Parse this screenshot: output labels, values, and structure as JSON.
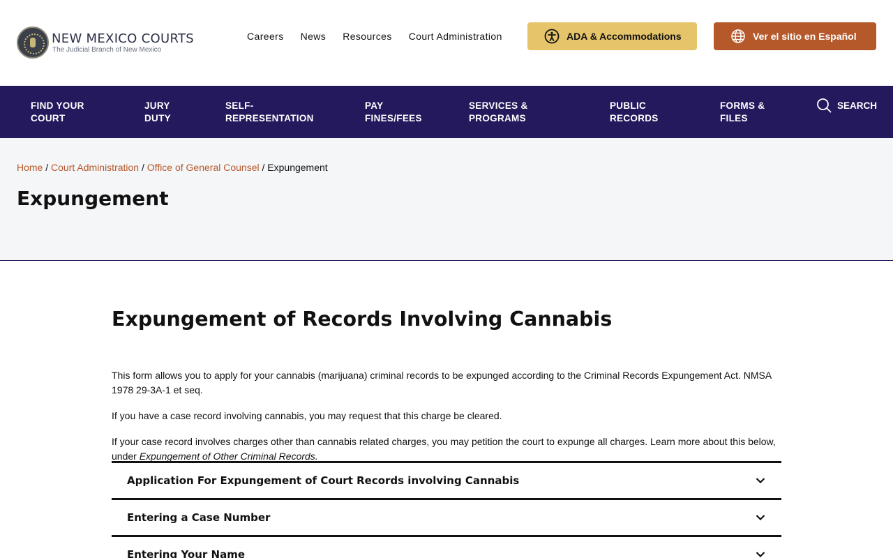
{
  "header": {
    "logo_title": "NEW MEXICO COURTS",
    "logo_subtitle": "The Judicial Branch of New Mexico",
    "top_links": [
      "Careers",
      "News",
      "Resources",
      "Court Administration"
    ],
    "ada_button": "ADA & Accommodations",
    "spanish_button": "Ver el sitio en Español"
  },
  "main_nav": {
    "items": [
      {
        "line1": "FIND YOUR",
        "line2": "COURT"
      },
      {
        "line1": "JURY",
        "line2": "DUTY"
      },
      {
        "line1": "SELF-",
        "line2": "REPRESENTATION"
      },
      {
        "line1": "PAY",
        "line2": "FINES/FEES"
      },
      {
        "line1": "SERVICES &",
        "line2": "PROGRAMS"
      },
      {
        "line1": "PUBLIC",
        "line2": "RECORDS"
      },
      {
        "line1": "FORMS &",
        "line2": "FILES"
      }
    ],
    "search_label": "SEARCH"
  },
  "breadcrumb": {
    "items": [
      "Home",
      "Court Administration",
      "Office of General Counsel"
    ],
    "current": "Expungement"
  },
  "page_title": "Expungement",
  "content": {
    "title": "Expungement of Records Involving Cannabis",
    "para1": "This form allows you to apply for your cannabis (marijuana) criminal records to be expunged according to the Criminal Records Expungement Act. NMSA 1978 29-3A-1 et seq.",
    "para2": "If you have a case record involving cannabis, you may request that this charge be cleared.",
    "para3_text": "If your case record involves charges other than cannabis related charges, you may petition the court to expunge all charges. Learn more about this below, under ",
    "para3_italic": "Expungement of Other Criminal Records.",
    "accordion": [
      "Application For Expungement of Court Records involving Cannabis",
      "Entering a Case Number",
      "Entering Your Name"
    ]
  },
  "colors": {
    "nav_bg": "#24195c",
    "ada_bg": "#e6c46a",
    "spanish_bg": "#b5582a",
    "link": "#b5582a"
  }
}
